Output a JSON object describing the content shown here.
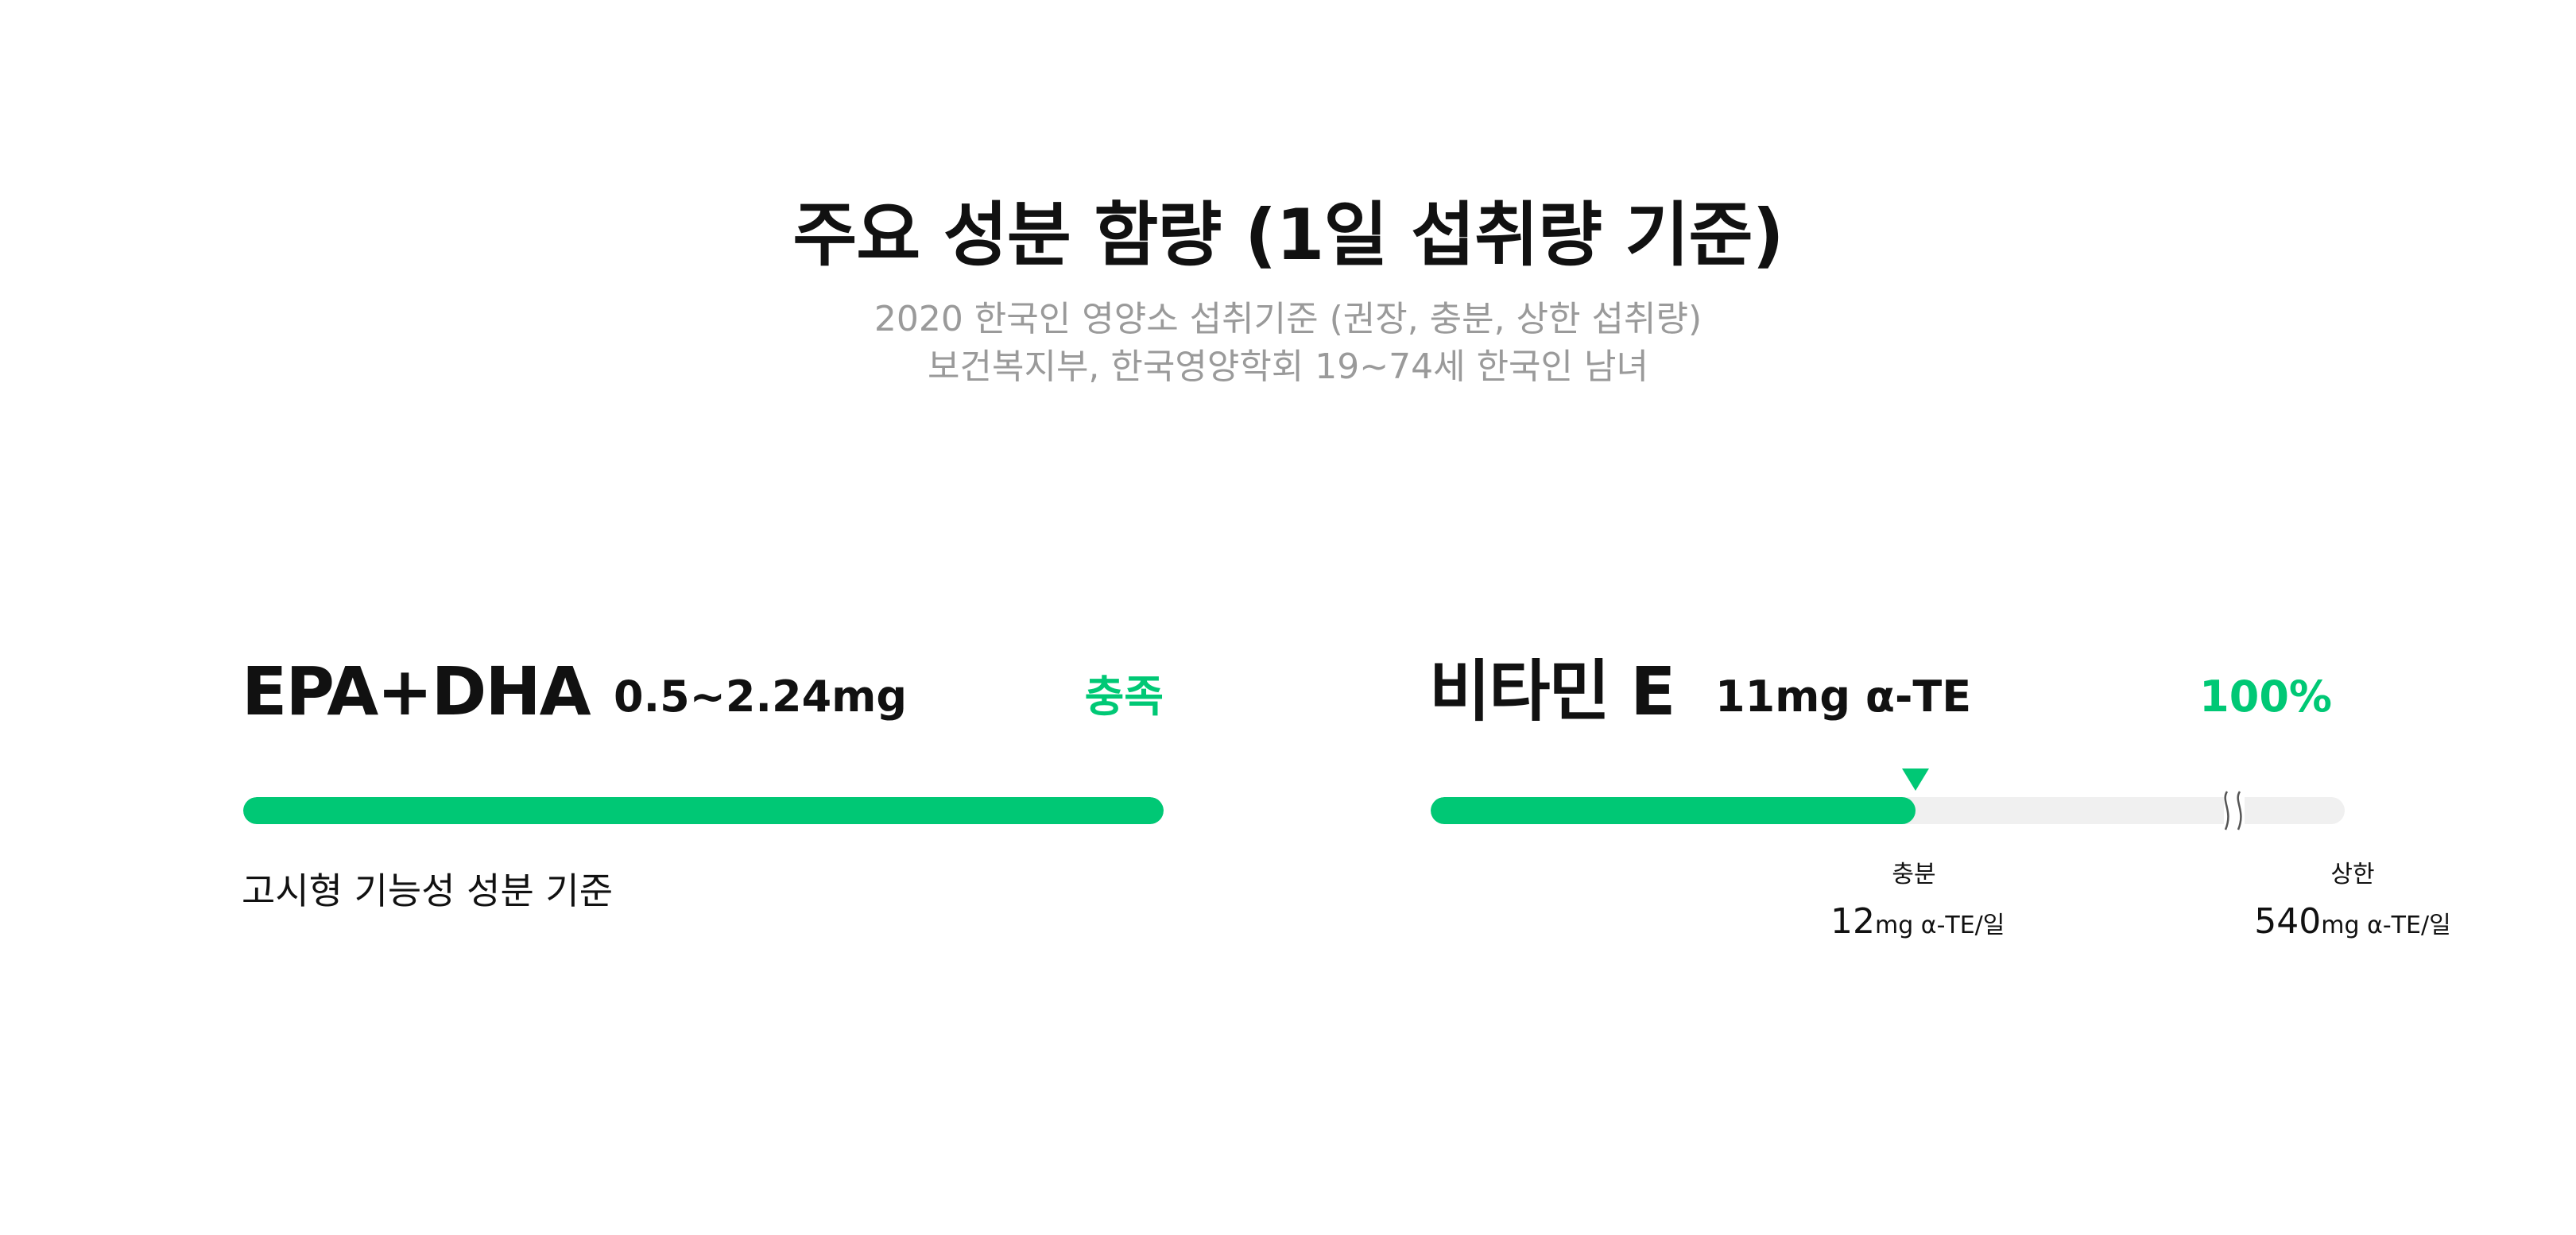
{
  "header": {
    "title": "주요 성분 함량 (1일 섭취량 기준)",
    "subtitle_line1": "2020 한국인 영양소 섭취기준 (권장, 충분, 상한 섭취량)",
    "subtitle_line2": "보건복지부, 한국영양학회  19~74세 한국인 남녀"
  },
  "nutrients": [
    {
      "name": "EPA+DHA",
      "amount": "0.5~2.24mg",
      "status": "충족",
      "fill_fraction": 1.0,
      "basis_note": "고시형 기능성 성분 기준"
    },
    {
      "name": "비타민 E",
      "amount": "11mg α-TE",
      "status": "100%",
      "fill_fraction": 0.53,
      "references": [
        {
          "label": "충분",
          "value": "12",
          "unit": "mg α-TE/일"
        },
        {
          "label": "상한",
          "value": "540",
          "unit": "mg α-TE/일"
        }
      ]
    }
  ],
  "colors": {
    "accent": "#00c875",
    "track": "#f0f0f0",
    "subtitle": "#9a9a9a",
    "text": "#111111"
  }
}
